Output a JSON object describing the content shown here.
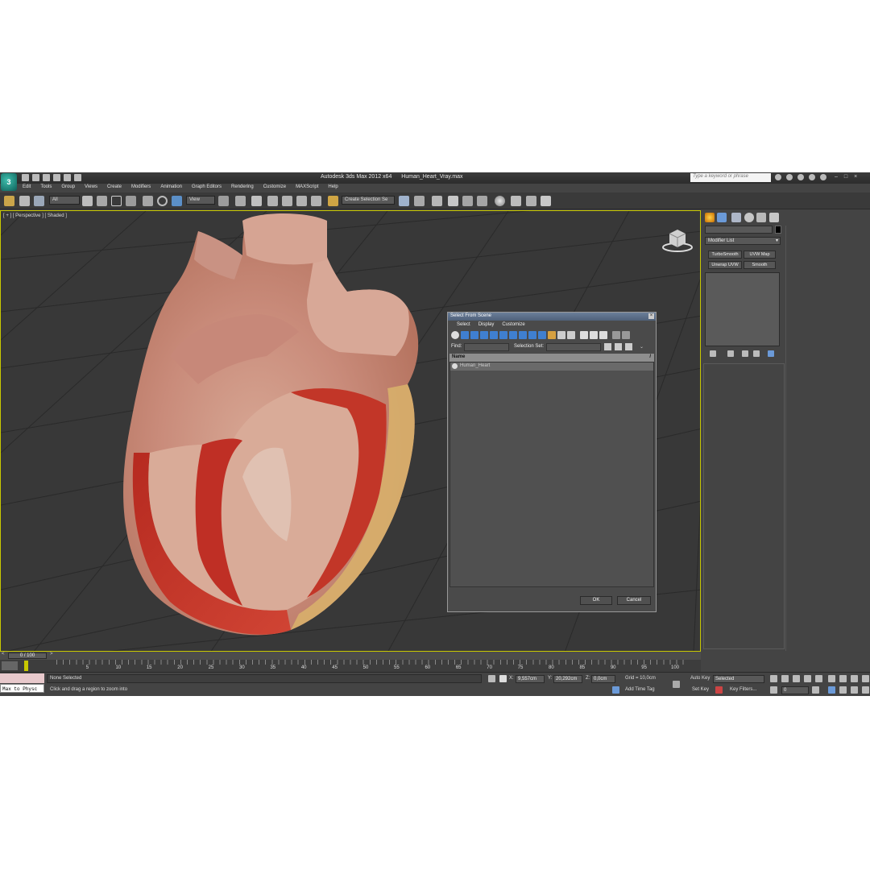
{
  "window": {
    "app_title": "Autodesk 3ds Max  2012 x64",
    "file_name": "Human_Heart_Vray.max",
    "search_placeholder": "Type a keyword or phrase"
  },
  "menu": [
    "Edit",
    "Tools",
    "Group",
    "Views",
    "Create",
    "Modifiers",
    "Animation",
    "Graph Editors",
    "Rendering",
    "Customize",
    "MAXScript",
    "Help"
  ],
  "toolbar": {
    "selection_filter": "All",
    "ref_coord": "View",
    "named_selection": "Create Selection Se"
  },
  "viewport": {
    "label": "[ + ] [ Perspective ] [ Shaded ]"
  },
  "dialog": {
    "title": "Select From Scene",
    "menu": [
      "Select",
      "Display",
      "Customize"
    ],
    "find_label": "Find:",
    "selection_set_label": "Selection Set:",
    "column_name": "Name",
    "column_sort": "/",
    "items": [
      "Human_Heart"
    ],
    "ok_label": "OK",
    "cancel_label": "Cancel"
  },
  "command_panel": {
    "modifier_list": "Modifier List",
    "buttons": [
      "TurboSmooth",
      "UVW Map",
      "Unwrap UVW",
      "Smooth"
    ]
  },
  "timeline": {
    "slider_label": "0 / 100",
    "ticks": [
      "5",
      "10",
      "15",
      "20",
      "25",
      "30",
      "35",
      "40",
      "45",
      "50",
      "55",
      "60",
      "65",
      "70",
      "75",
      "80",
      "85",
      "90",
      "95",
      "100"
    ]
  },
  "status": {
    "maxscript_listener": "Max to Physc",
    "selection_status": "None Selected",
    "prompt": "Click and drag a region to zoom into",
    "x_label": "X:",
    "x_value": "9,557cm",
    "y_label": "Y:",
    "y_value": "20,292cm",
    "z_label": "Z:",
    "z_value": "0,0cm",
    "grid": "Grid = 10,0cm",
    "add_time_tag": "Add Time Tag",
    "auto_key": "Auto Key",
    "auto_key_mode": "Selected",
    "set_key": "Set Key",
    "key_filters": "Key Filters...",
    "frame": "0"
  },
  "colors": {
    "ui_dark": "#444444",
    "viewport_bg": "#383838",
    "active_border": "#c8c800",
    "dialog_title": "#5b6d88",
    "tool_blue": "#3f7fd0"
  }
}
